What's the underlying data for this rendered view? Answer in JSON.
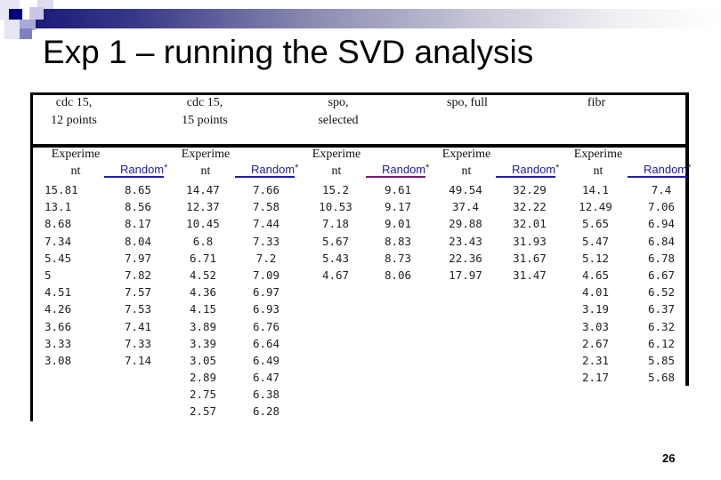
{
  "slide": {
    "title": "Exp 1 – running the SVD analysis",
    "page_number": "26",
    "accent_color": "#000080"
  },
  "table": {
    "datasets": [
      {
        "name_line1": "cdc 15,",
        "name_line2": "12  points"
      },
      {
        "name_line1": "cdc 15,",
        "name_line2": "15  points"
      },
      {
        "name_line1": "spo,",
        "name_line2": "selected"
      },
      {
        "name_line1": "",
        "name_line2": "spo,  full"
      },
      {
        "name_line1": "",
        "name_line2": "fibr"
      }
    ],
    "subheaders": {
      "experiment_line1": "Experime",
      "experiment_line2": "nt",
      "random": "Random",
      "random_mark": "*"
    },
    "columns": [
      {
        "dataset": "cdc 15, 12 points",
        "type": "Experiment",
        "values": [
          "15.81",
          "13.1",
          "8.68",
          "7.34",
          "5.45",
          "5",
          "4.51",
          "4.26",
          "3.66",
          "3.33",
          "3.08"
        ]
      },
      {
        "dataset": "cdc 15, 12 points",
        "type": "Random*",
        "values": [
          "8.65",
          "8.56",
          "8.17",
          "8.04",
          "7.97",
          "7.82",
          "7.57",
          "7.53",
          "7.41",
          "7.33",
          "7.14"
        ]
      },
      {
        "dataset": "cdc 15, 15 points",
        "type": "Experiment",
        "values": [
          "14.47",
          "12.37",
          "10.45",
          "6.8",
          "6.71",
          "4.52",
          "4.36",
          "4.15",
          "3.89",
          "3.39",
          "3.05",
          "2.89",
          "2.75",
          "2.57"
        ]
      },
      {
        "dataset": "cdc 15, 15 points",
        "type": "Random*",
        "values": [
          "7.66",
          "7.58",
          "7.44",
          "7.33",
          "7.2",
          "7.09",
          "6.97",
          "6.93",
          "6.76",
          "6.64",
          "6.49",
          "6.47",
          "6.38",
          "6.28"
        ]
      },
      {
        "dataset": "spo, selected",
        "type": "Experiment",
        "values": [
          "15.2",
          "10.53",
          "7.18",
          "5.67",
          "5.43",
          "4.67"
        ]
      },
      {
        "dataset": "spo, selected",
        "type": "Random*",
        "values": [
          "9.61",
          "9.17",
          "9.01",
          "8.83",
          "8.73",
          "8.06"
        ]
      },
      {
        "dataset": "spo, full",
        "type": "Experiment",
        "values": [
          "49.54",
          "37.4",
          "29.88",
          "23.43",
          "22.36",
          "17.97"
        ]
      },
      {
        "dataset": "spo, full",
        "type": "Random*",
        "values": [
          "32.29",
          "32.22",
          "32.01",
          "31.93",
          "31.67",
          "31.47"
        ]
      },
      {
        "dataset": "fibr",
        "type": "Experiment",
        "values": [
          "14.1",
          "12.49",
          "5.65",
          "5.47",
          "5.12",
          "4.65",
          "4.01",
          "3.19",
          "3.03",
          "2.67",
          "2.31",
          "2.17"
        ]
      },
      {
        "dataset": "fibr",
        "type": "Random*",
        "values": [
          "7.4",
          "7.06",
          "6.94",
          "6.84",
          "6.78",
          "6.67",
          "6.52",
          "6.37",
          "6.32",
          "6.12",
          "5.85",
          "5.68"
        ]
      }
    ]
  }
}
